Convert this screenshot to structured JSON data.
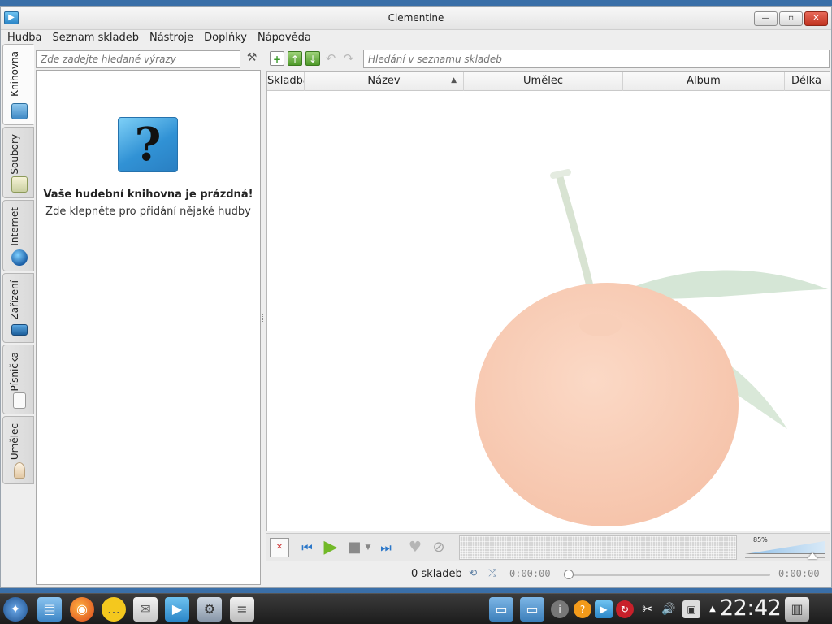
{
  "window": {
    "title": "Clementine",
    "minimize_glyph": "—",
    "maximize_glyph": "▫",
    "close_glyph": "✕"
  },
  "menubar": {
    "items": [
      "Hudba",
      "Seznam skladeb",
      "Nástroje",
      "Doplňky",
      "Nápověda"
    ]
  },
  "sidebar_tabs": [
    {
      "label": "Knihovna",
      "icon": "library-icon",
      "active": true
    },
    {
      "label": "Soubory",
      "icon": "files-icon",
      "active": false
    },
    {
      "label": "Internet",
      "icon": "internet-globe-icon",
      "active": false
    },
    {
      "label": "Zařízení",
      "icon": "device-icon",
      "active": false
    },
    {
      "label": "Písnička",
      "icon": "song-lyrics-icon",
      "active": false
    },
    {
      "label": "Umělec",
      "icon": "artist-icon",
      "active": false
    }
  ],
  "library": {
    "search_placeholder": "Zde zadejte hledané výrazy",
    "empty_title": "Vaše hudební knihovna je prázdná!",
    "empty_subtitle": "Zde klepněte pro přidání nějaké hudby"
  },
  "playlist": {
    "search_placeholder": "Hledání v seznamu skladeb",
    "columns": [
      "Skladba",
      "Název",
      "Umělec",
      "Album",
      "Délka"
    ],
    "sort_indicator": "▲",
    "track_count": "0 skladeb"
  },
  "player": {
    "volume_percent": "85%",
    "volume_level": 0.85,
    "time_elapsed": "0:00:00",
    "time_total": "0:00:00"
  },
  "taskbar": {
    "clock": "22:42"
  },
  "colors": {
    "accent": "#2b86c8",
    "close_button": "#c0321f",
    "taskbar": "#2a2a2a"
  }
}
